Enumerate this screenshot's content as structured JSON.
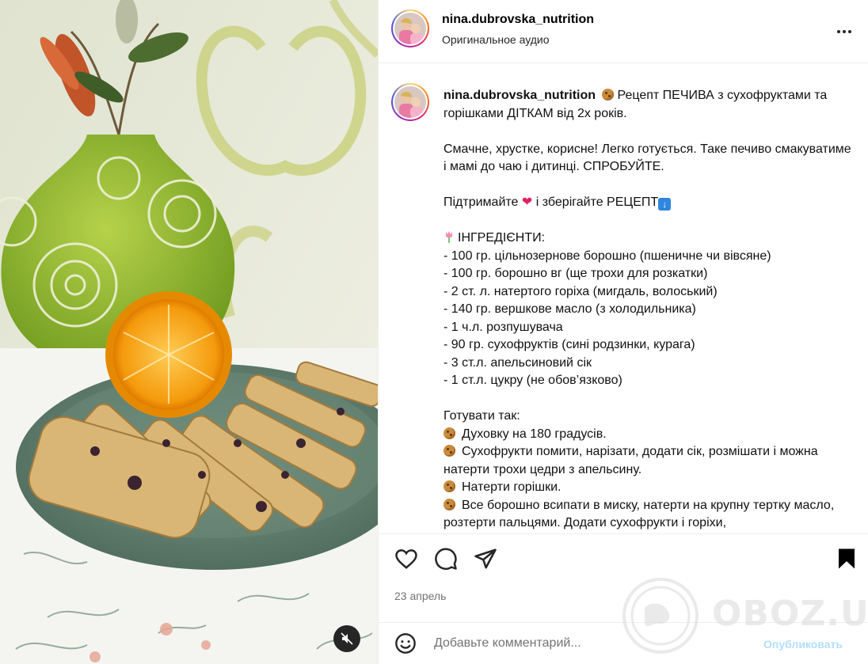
{
  "post": {
    "username": "nina.dubrovska_nutrition",
    "audio_label": "Оригинальное аудио",
    "date": "23 апрель"
  },
  "caption": {
    "username": "nina.dubrovska_nutrition",
    "lines": {
      "title": "Рецепт ПЕЧИВА з сухофруктами та горішками ДІТКАМ від 2х років.",
      "intro": "Смачне, хрустке, корисне! Легко готується. Таке печиво смакуватиме і мамі до чаю і дитинці. СПРОБУЙТЕ.",
      "support_a": "Підтримайте",
      "support_b": "і зберігайте РЕЦЕПТ",
      "ingredients_header": "ІНГРЕДІЄНТИ:",
      "ing1": "- 100 гр. цільнозернове борошно (пшеничне чи вівсяне)",
      "ing2": "- 100 гр. борошно вг (ще трохи для розкатки)",
      "ing3": "- 2 ст. л. натертого горіха (мигдаль, волоський)",
      "ing4": "- 140 гр. вершкове масло (з холодильника)",
      "ing5": "- 1 ч.л. розпушувача",
      "ing6": "- 90 гр. сухофруктів (сині родзинки, курага)",
      "ing7": "- 3 ст.л. апельсиновий сік",
      "ing8": "- 1 ст.л. цукру (не обов’язково)",
      "method_header": "Готувати так:",
      "step1": "Духовку на 180 градусів.",
      "step2": "Сухофрукти помити, нарізати, додати сік, розмішати і можна натерти трохи цедри з апельсину.",
      "step3": "Натерти горішки.",
      "step4": "Все борошно всипати в миску, натерти на крупну тертку масло, розтерти пальцями. Додати сухофрукти і горіхи,"
    }
  },
  "comment": {
    "placeholder": "Добавьте комментарий...",
    "publish_label": "Опубликовать"
  },
  "watermark": {
    "text": "OBOZ.UA"
  },
  "icons": {
    "more": "more-options-icon",
    "like": "heart-outline-icon",
    "comment": "comment-bubble-icon",
    "share": "paper-plane-icon",
    "save": "bookmark-filled-icon",
    "emoji": "smiley-icon",
    "mute": "speaker-muted-icon"
  },
  "colors": {
    "publish": "#b2dffc",
    "accent_heart": "#e0245e",
    "muted_text": "#737373"
  }
}
